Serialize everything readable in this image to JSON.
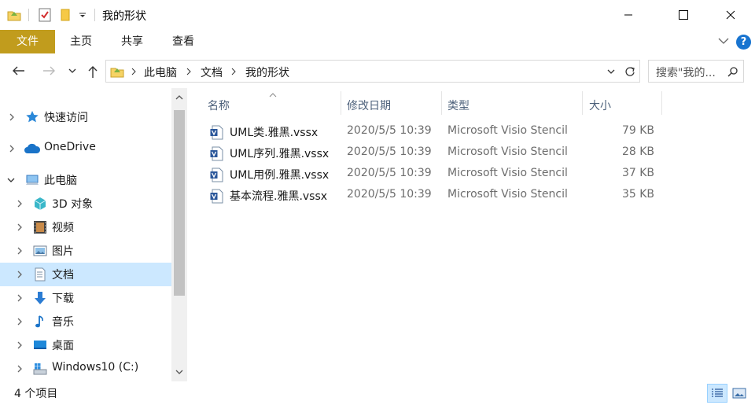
{
  "window": {
    "title": "我的形状",
    "controls": {
      "minimize": "minimize-icon",
      "maximize": "maximize-icon",
      "close": "close-icon"
    }
  },
  "ribbon": {
    "tabs": [
      {
        "label": "文件"
      },
      {
        "label": "主页"
      },
      {
        "label": "共享"
      },
      {
        "label": "查看"
      }
    ],
    "help": "?"
  },
  "address": {
    "breadcrumbs": [
      "此电脑",
      "文档",
      "我的形状"
    ],
    "search_placeholder": "搜索\"我的..."
  },
  "nav": {
    "items": [
      {
        "label": "快速访问",
        "icon": "quick-access-star-icon",
        "expanded": false,
        "level": 0
      },
      {
        "label": "OneDrive",
        "icon": "onedrive-cloud-icon",
        "expanded": false,
        "level": 0
      },
      {
        "label": "此电脑",
        "icon": "this-pc-icon",
        "expanded": true,
        "level": 0
      },
      {
        "label": "3D 对象",
        "icon": "3d-objects-icon",
        "expanded": false,
        "level": 1
      },
      {
        "label": "视频",
        "icon": "videos-icon",
        "expanded": false,
        "level": 1
      },
      {
        "label": "图片",
        "icon": "pictures-icon",
        "expanded": false,
        "level": 1
      },
      {
        "label": "文档",
        "icon": "documents-icon",
        "expanded": false,
        "level": 1,
        "selected": true
      },
      {
        "label": "下载",
        "icon": "downloads-icon",
        "expanded": false,
        "level": 1
      },
      {
        "label": "音乐",
        "icon": "music-icon",
        "expanded": false,
        "level": 1
      },
      {
        "label": "桌面",
        "icon": "desktop-icon",
        "expanded": false,
        "level": 1
      },
      {
        "label": "Windows10 (C:)",
        "icon": "drive-icon",
        "expanded": false,
        "level": 1
      }
    ]
  },
  "files": {
    "columns": [
      "名称",
      "修改日期",
      "类型",
      "大小"
    ],
    "rows": [
      {
        "name": "UML类.雅黑.vssx",
        "date": "2020/5/5 10:39",
        "type": "Microsoft Visio Stencil",
        "size": "79 KB"
      },
      {
        "name": "UML序列.雅黑.vssx",
        "date": "2020/5/5 10:39",
        "type": "Microsoft Visio Stencil",
        "size": "28 KB"
      },
      {
        "name": "UML用例.雅黑.vssx",
        "date": "2020/5/5 10:39",
        "type": "Microsoft Visio Stencil",
        "size": "37 KB"
      },
      {
        "name": "基本流程.雅黑.vssx",
        "date": "2020/5/5 10:39",
        "type": "Microsoft Visio Stencil",
        "size": "35 KB"
      }
    ]
  },
  "status": {
    "item_count": "4 个项目"
  },
  "colors": {
    "file_tab": "#c19c1d",
    "selection": "#cce8ff",
    "accent": "#1874d0"
  }
}
